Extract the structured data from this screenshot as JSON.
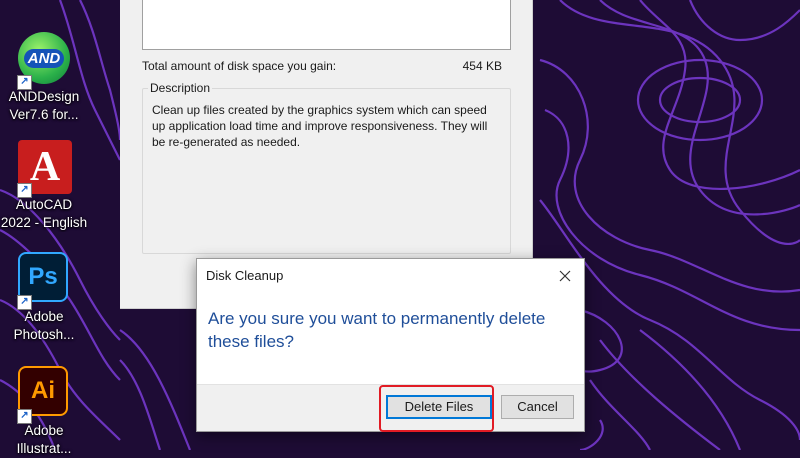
{
  "desktop": {
    "icons": [
      {
        "name": "ANDDesign",
        "line1": "ANDDesign",
        "line2": "Ver7.6 for...",
        "glyph": "AND"
      },
      {
        "name": "AutoCAD",
        "line1": "AutoCAD",
        "line2": "2022 - English",
        "glyph": "A"
      },
      {
        "name": "Photoshop",
        "line1": "Adobe",
        "line2": "Photosh...",
        "glyph": "Ps"
      },
      {
        "name": "Illustrator",
        "line1": "Adobe",
        "line2": "Illustrat...",
        "glyph": "Ai"
      }
    ],
    "shortcut_glyph": "↗"
  },
  "cleanup_window": {
    "gain_label": "Total amount of disk space you gain:",
    "gain_value": "454 KB",
    "description_label": "Description",
    "description_text": "Clean up files created by the graphics system which can speed up application load time and improve responsiveness. They will be re-generated as needed."
  },
  "dialog": {
    "title": "Disk Cleanup",
    "close_glyph": "✕",
    "message": "Are you sure you want to permanently delete these files?",
    "delete_label": "Delete Files",
    "cancel_label": "Cancel"
  },
  "colors": {
    "wallpaper": "#1e0c35",
    "contour": "#7a3bd6",
    "message_text": "#1f4e99",
    "highlight": "#e11b24",
    "focus_border": "#0078d7"
  }
}
